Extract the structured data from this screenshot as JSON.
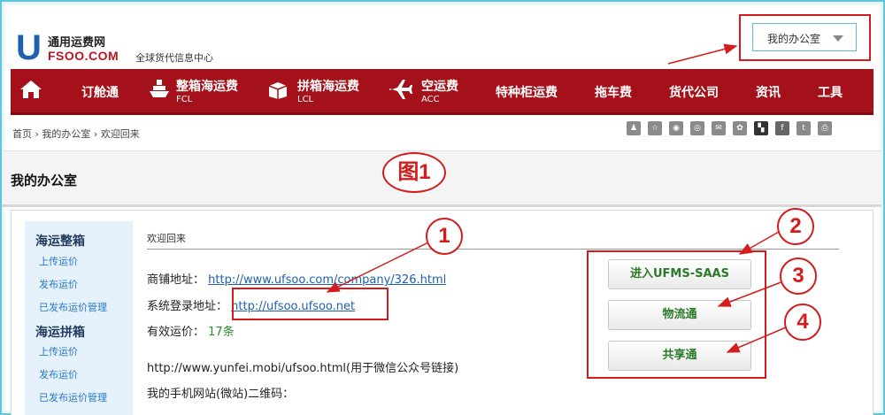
{
  "header": {
    "logo_letter": "U",
    "site_name": "通用运费网",
    "domain": "FSOO.COM",
    "tagline": "全球货代信息中心",
    "office_dropdown": "我的办公室"
  },
  "nav": {
    "items": [
      {
        "label": "订舱通",
        "sub": ""
      },
      {
        "label": "整箱海运费",
        "sub": "FCL"
      },
      {
        "label": "拼箱海运费",
        "sub": "LCL"
      },
      {
        "label": "空运费",
        "sub": "ACC"
      },
      {
        "label": "特种柜运费",
        "sub": ""
      },
      {
        "label": "拖车费",
        "sub": ""
      },
      {
        "label": "货代公司",
        "sub": ""
      },
      {
        "label": "资讯",
        "sub": ""
      },
      {
        "label": "工具",
        "sub": ""
      }
    ]
  },
  "breadcrumb": {
    "items": [
      "首页",
      "我的办公室",
      "欢迎回来"
    ],
    "separator": "›"
  },
  "page_title": "我的办公室",
  "sidebar": {
    "sections": [
      {
        "heading": "海运整箱",
        "links": [
          "上传运价",
          "发布运价",
          "已发布运价管理"
        ]
      },
      {
        "heading": "海运拼箱",
        "links": [
          "上传运价",
          "发布运价",
          "已发布运价管理"
        ]
      }
    ]
  },
  "main": {
    "welcome": "欢迎回来",
    "shop_label": "商铺地址：",
    "shop_url": "http://www.ufsoo.com/company/326.html",
    "login_label": "系统登录地址：",
    "login_url": "http://ufsoo.ufsoo.net",
    "valid_label": "有效运价：",
    "valid_value": "17条",
    "mobile_link_text": "http://www.yunfei.mobi/ufsoo.html(用于微信公众号链接)",
    "qr_label": "我的手机网站(微站)二维码："
  },
  "actions": {
    "saas": "进入UFMS-SAAS",
    "logistics": "物流通",
    "share": "共享通"
  },
  "annotations": {
    "figure_label": "图1",
    "numbers": [
      "1",
      "2",
      "3",
      "4"
    ]
  },
  "colors": {
    "nav_bg": "#a5111a",
    "accent_blue": "#1f5fae",
    "annotation_red": "#d41c1c",
    "action_green": "#2a7a2a"
  }
}
